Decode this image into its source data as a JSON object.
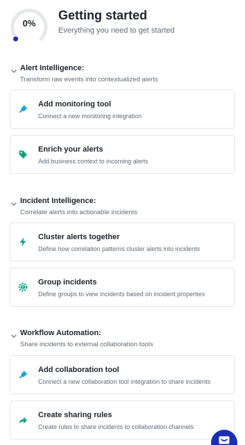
{
  "header": {
    "progress": 0.0,
    "progress_label": "0%",
    "title": "Getting started",
    "subtitle": "Everything you need to get started"
  },
  "colors": {
    "accent": "#1a2eb5",
    "icon_blue": "#1aa3d6",
    "icon_green": "#0fa37f",
    "ring_track": "#e6e8ea"
  },
  "sections": [
    {
      "title": "Alert Intelligence:",
      "subtitle": "Transform raw events into contextualized alerts",
      "cards": [
        {
          "title": "Add monitoring tool",
          "desc": "Connect a new monitoring integration",
          "icon": "plug-icon"
        },
        {
          "title": "Enrich your alerts",
          "desc": "Add business context to incoming alerts",
          "icon": "tag-icon"
        }
      ]
    },
    {
      "title": "Incident Intelligence:",
      "subtitle": "Correlate alerts into actionable incidents",
      "cards": [
        {
          "title": "Cluster alerts together",
          "desc": "Define how correlation patterns cluster alerts into incidents",
          "icon": "lightning-icon"
        },
        {
          "title": "Group incidents",
          "desc": "Define groups to view incidents based on incident properties",
          "icon": "group-gear-icon"
        }
      ]
    },
    {
      "title": "Workflow Automation:",
      "subtitle": "Share incidents to external collaboration tools",
      "cards": [
        {
          "title": "Add collaboration tool",
          "desc": "Connect a new collaboration tool integration to share incidents",
          "icon": "plug-icon"
        },
        {
          "title": "Create sharing rules",
          "desc": "Create rules to share incidents to collaboration channels",
          "icon": "share-arrow-icon"
        }
      ]
    }
  ],
  "fab": {
    "icon": "chat-icon"
  }
}
